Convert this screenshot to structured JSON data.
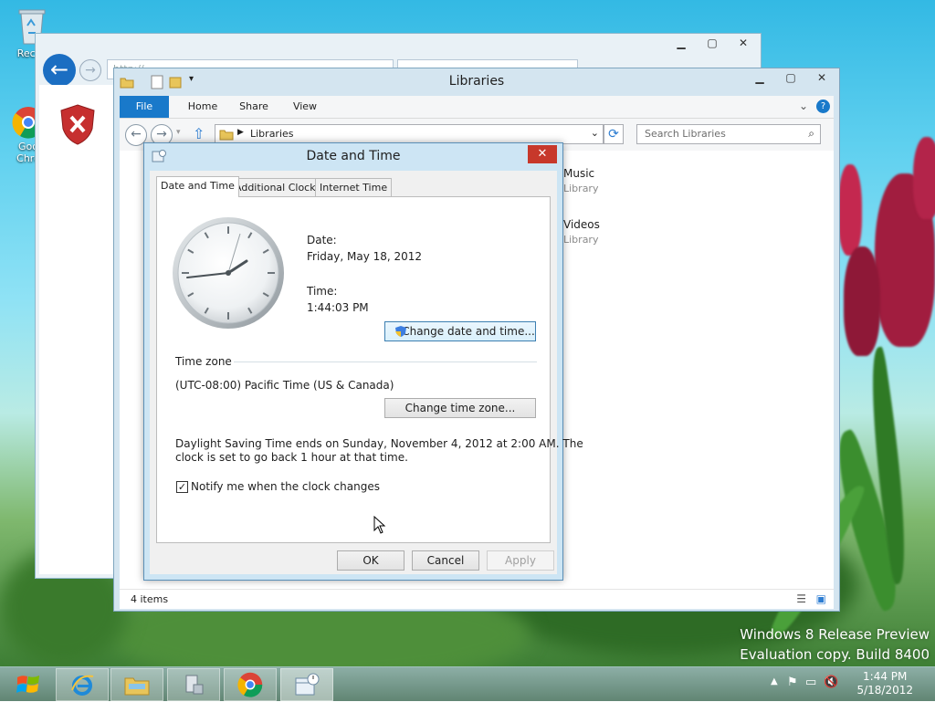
{
  "desktop": {
    "icons": [
      {
        "label": "Recyc",
        "icon": "recycle-bin-icon"
      },
      {
        "label": "Goo Chro",
        "icon": "chrome-icon"
      }
    ],
    "watermark": {
      "line1": "Windows 8 Release Preview",
      "line2": "Evaluation copy. Build 8400"
    }
  },
  "ie_window": {
    "address_text": "http://",
    "tab_text": ""
  },
  "explorer": {
    "title": "Libraries",
    "ribbon_tabs": [
      "File",
      "Home",
      "Share",
      "View"
    ],
    "address": "Libraries",
    "search_placeholder": "Search Libraries",
    "items": [
      {
        "name": "Music",
        "type": "Library"
      },
      {
        "name": "Videos",
        "type": "Library"
      }
    ],
    "status": "4 items"
  },
  "dialog": {
    "title": "Date and Time",
    "tabs": [
      "Date and Time",
      "Additional Clocks",
      "Internet Time"
    ],
    "date_label": "Date:",
    "date_value": "Friday, May 18, 2012",
    "time_label": "Time:",
    "time_value": "1:44:03 PM",
    "change_date_button": "Change date and time...",
    "time_zone_heading": "Time zone",
    "time_zone_value": "(UTC-08:00) Pacific Time (US & Canada)",
    "change_tz_button": "Change time zone...",
    "dst_line1": "Daylight Saving Time ends on Sunday, November 4, 2012 at 2:00 AM. The",
    "dst_line2": "clock is set to go back 1 hour at that time.",
    "notify_label": "Notify me when the clock changes",
    "notify_checked": true,
    "ok": "OK",
    "cancel": "Cancel",
    "apply": "Apply"
  },
  "taskbar": {
    "clock_time": "1:44 PM",
    "clock_date": "5/18/2012"
  },
  "colors": {
    "accent": "#1979ca",
    "close_red": "#c7382b"
  }
}
